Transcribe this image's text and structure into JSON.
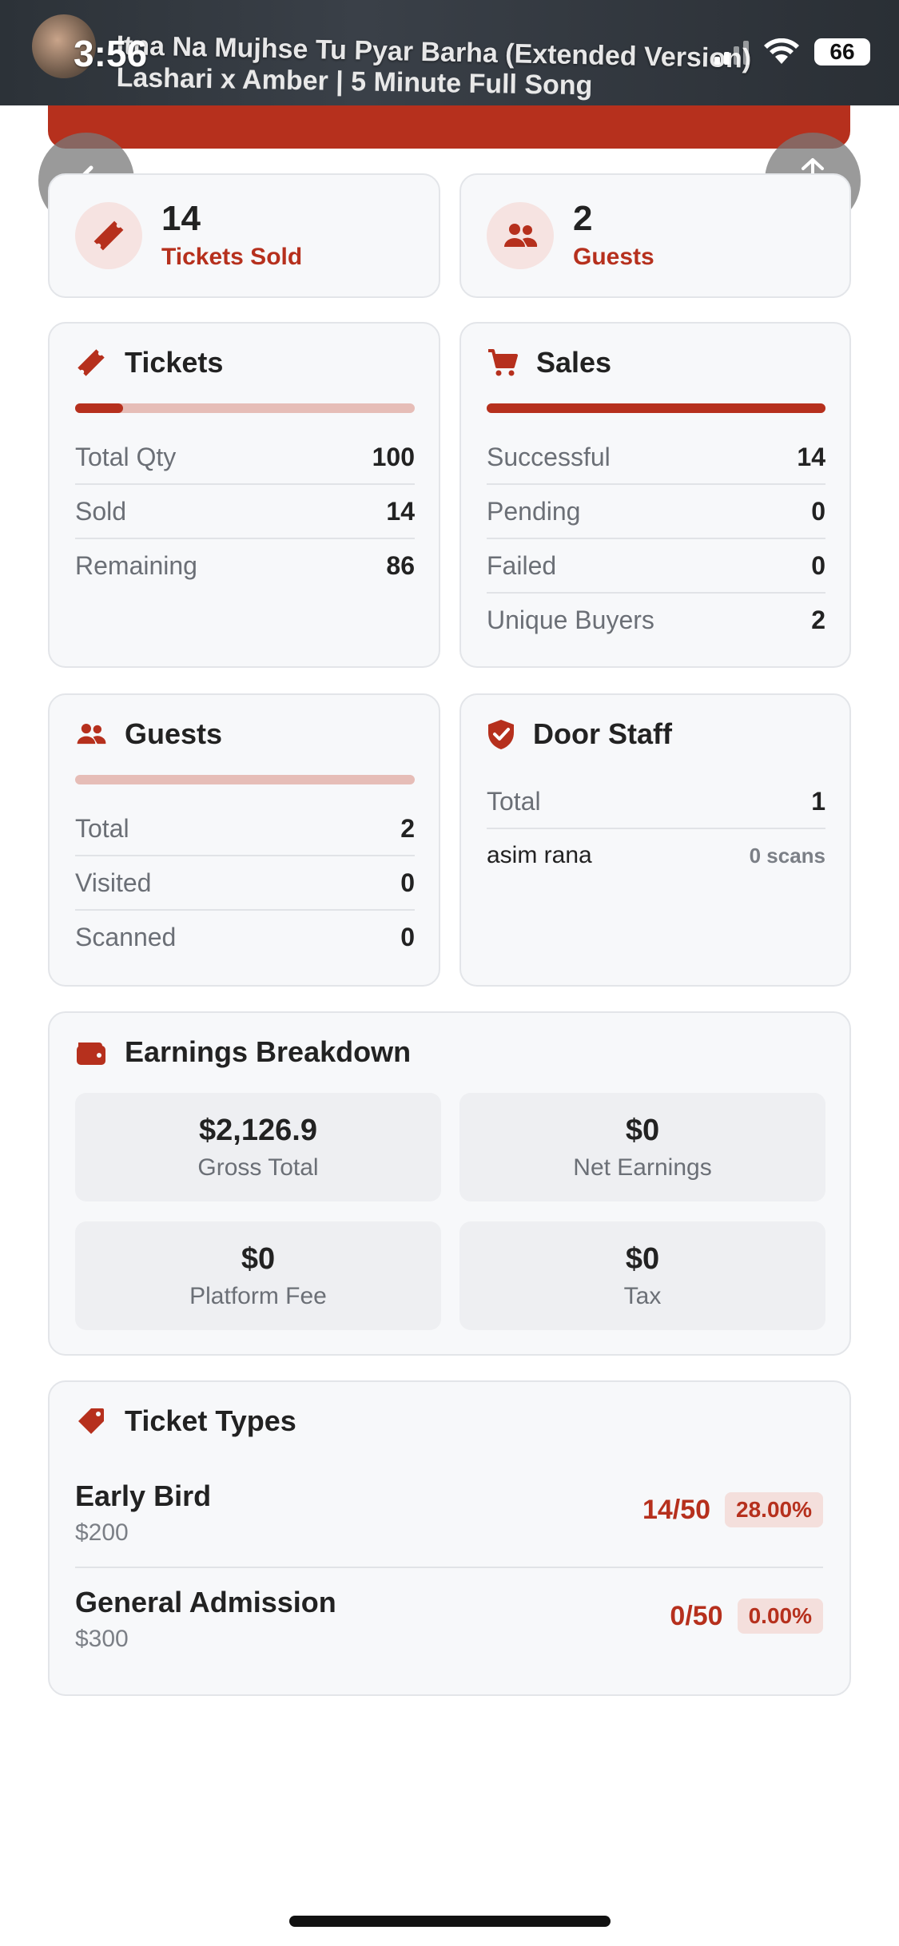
{
  "status_bar": {
    "time": "3:56",
    "battery": "66",
    "media_title": "Itna Na Mujhse Tu Pyar Barha (Extended Version)",
    "media_subtitle": "Lashari x Amber | 5 Minute Full Song"
  },
  "summary": {
    "tickets_sold_value": "14",
    "tickets_sold_label": "Tickets Sold",
    "guests_value": "2",
    "guests_label": "Guests"
  },
  "tickets_card": {
    "title": "Tickets",
    "progress_fraction": 0.14,
    "rows": [
      {
        "label": "Total Qty",
        "value": "100"
      },
      {
        "label": "Sold",
        "value": "14"
      },
      {
        "label": "Remaining",
        "value": "86"
      }
    ]
  },
  "sales_card": {
    "title": "Sales",
    "progress_fraction": 1.0,
    "rows": [
      {
        "label": "Successful",
        "value": "14"
      },
      {
        "label": "Pending",
        "value": "0"
      },
      {
        "label": "Failed",
        "value": "0"
      },
      {
        "label": "Unique Buyers",
        "value": "2"
      }
    ]
  },
  "guests_card": {
    "title": "Guests",
    "progress_fraction": 0.0,
    "rows": [
      {
        "label": "Total",
        "value": "2"
      },
      {
        "label": "Visited",
        "value": "0"
      },
      {
        "label": "Scanned",
        "value": "0"
      }
    ]
  },
  "door_staff_card": {
    "title": "Door Staff",
    "total_label": "Total",
    "total_value": "1",
    "staff": [
      {
        "name": "asim rana",
        "scans": "0 scans"
      }
    ]
  },
  "earnings": {
    "title": "Earnings Breakdown",
    "items": [
      {
        "value": "$2,126.9",
        "label": "Gross Total"
      },
      {
        "value": "$0",
        "label": "Net Earnings"
      },
      {
        "value": "$0",
        "label": "Platform Fee"
      },
      {
        "value": "$0",
        "label": "Tax"
      }
    ]
  },
  "ticket_types": {
    "title": "Ticket Types",
    "items": [
      {
        "name": "Early Bird",
        "price": "$200",
        "count": "14/50",
        "percent": "28.00%"
      },
      {
        "name": "General Admission",
        "price": "$300",
        "count": "0/50",
        "percent": "0.00%"
      }
    ]
  },
  "colors": {
    "accent": "#b6301d",
    "accent_light": "#e6bdb7",
    "card_bg": "#f7f8fa"
  }
}
